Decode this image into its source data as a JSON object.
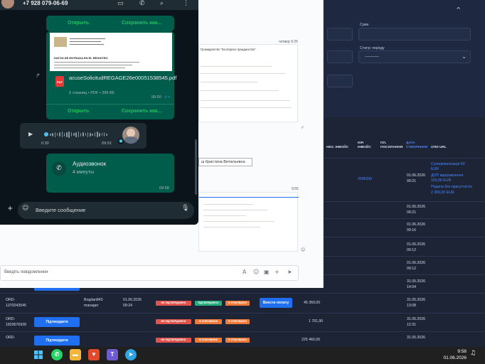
{
  "whatsapp": {
    "phone": "+7 928 079-06-69",
    "open_label": "Открыть",
    "save_label": "Сохранить как...",
    "pdf_file_name": "acuseSolicitudREGAGE26e00051538545.pdf",
    "pdf_meta": "6 страниц • PDF • 295 КБ",
    "pdf_time": "09:50",
    "voice_elapsed": "0:30",
    "voice_time": "09:52",
    "call_title": "Аудиозвонок",
    "call_duration": "4 минуты",
    "call_time": "09:58",
    "input_placeholder": "Введите сообщение",
    "doc_heading": "DATOS DE ENTRADA EN EL REGISTRO"
  },
  "browser": {
    "msg_time_1": "четвер 9:25",
    "doc_subject": "Громадянство \"Българско гражданство\".",
    "name_chip": "ш Кристина Витальевна",
    "msg_time_2": "9:55",
    "compose_placeholder": "Введіть повідомлення"
  },
  "admin": {
    "filter_sum_label": "Сума",
    "filter_status_label": "Статус періоду",
    "filter_status_value": "----------",
    "columns": {
      "inc_invoice": "НЕЗ. ІНВОЙС",
      "legal_invoice": "ЮР. ІНВОЙС",
      "pp_posylannya": "ПЛ. ПОСИЛАННЯ",
      "created_at": "ДАТА СТВОРЕННЯ",
      "service_url": "ОПИ URL"
    },
    "top_rows": [
      {
        "legal": "2006336",
        "date": "01.06.2026",
        "time": "09:21",
        "link1": "Супервізалізація 60 EUR",
        "link2": "ДОП відправлення 150,00 EUR",
        "link3": "Подача без присутністю",
        "link4": "2 360,00 EUR"
      },
      {
        "date": "01.06.2026",
        "time": "09:21"
      },
      {
        "date": "01.06.2026",
        "time": "09:16"
      },
      {
        "date": "01.06.2026",
        "time": "09:12"
      },
      {
        "date": "01.06.2026",
        "time": "09:12"
      },
      {
        "date": "31.05.2026",
        "time": "14:04"
      }
    ],
    "rows": [
      {
        "order": "ORD-",
        "order2": "1370243545",
        "manager": "Bogdan843",
        "manager2": "manager",
        "date": "01.06.2026",
        "time": "09:24",
        "badge1": "НЕ ПІДТВЕРДЖЕНО",
        "badge2": "ПІДТВЕРДЖЕНО",
        "badge3": "В ОЧІКУВАННІ",
        "action": "Внести оплату",
        "amount": "45 360,00",
        "created": "31.05.2026",
        "created_time": "13:08"
      },
      {
        "order": "ORD-",
        "order2": "1823676939",
        "button": "Підтвердити",
        "badge1": "НЕ ПІДТВЕРДЖЕНО",
        "badge2": "В ОЧІКУВАННІ",
        "badge3": "В ОЧІКУВАННІ",
        "amount": "1 761,90",
        "created": "31.05.2026",
        "created_time": "12:31"
      },
      {
        "order": "ORD-",
        "button": "Підтвердити",
        "badge1": "НЕ ПІДТВЕРДЖЕНО",
        "badge2": "В ОЧІКУВАННІ",
        "badge3": "В ОЧІКУВАННІ",
        "amount": "225 460,00",
        "created": "31.05.2026"
      }
    ]
  },
  "taskbar": {
    "time": "9:58",
    "date": "01.06.2026"
  },
  "colors": {
    "wa_bubble": "#005c4b",
    "wa_accent": "#21c063",
    "admin_blue": "#1f6ff0",
    "badge_red": "#e0524a",
    "badge_green": "#23b07d",
    "badge_orange": "#f07a3a"
  }
}
